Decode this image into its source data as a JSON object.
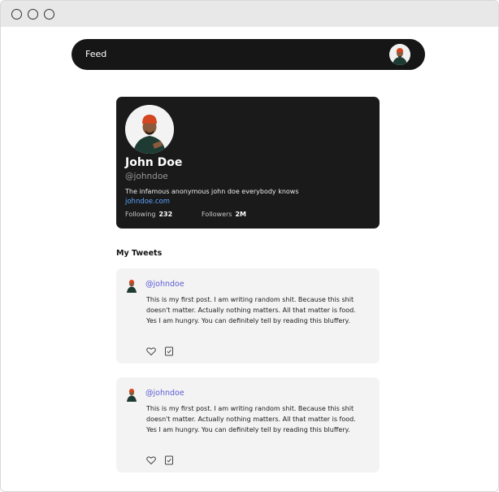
{
  "navbar": {
    "title": "Feed",
    "avatar_icon": "user-avatar"
  },
  "profile": {
    "name": "John Doe",
    "handle": "@johndoe",
    "bio": "The infamous anonymous john doe everybody knows",
    "website": "johndoe.com",
    "following_label": "Following",
    "following_count": "232",
    "followers_label": "Followers",
    "followers_count": "2M"
  },
  "tweets_section": {
    "title": "My Tweets"
  },
  "tweets": [
    {
      "handle": "@johndoe",
      "text": "This is my first post. I am writing random shit. Because this shit doesn't matter. Actually nothing matters. All that matter is food. Yes I am hungry. You can definitely tell by reading this bluffery.",
      "icons": [
        "heart-icon",
        "bookmark-icon"
      ]
    },
    {
      "handle": "@johndoe",
      "text": "This is my first post. I am writing random shit. Because this shit doesn't matter. Actually nothing matters. All that matter is food. Yes I am hungry. You can definitely tell by reading this bluffery.",
      "icons": [
        "heart-icon",
        "bookmark-icon"
      ]
    }
  ],
  "colors": {
    "navbar_bg": "#161616",
    "card_bg": "#1a1a1a",
    "tweet_bg": "#f3f3f3",
    "handle_color": "#5b5bd6",
    "link_color": "#5aa2ff"
  }
}
